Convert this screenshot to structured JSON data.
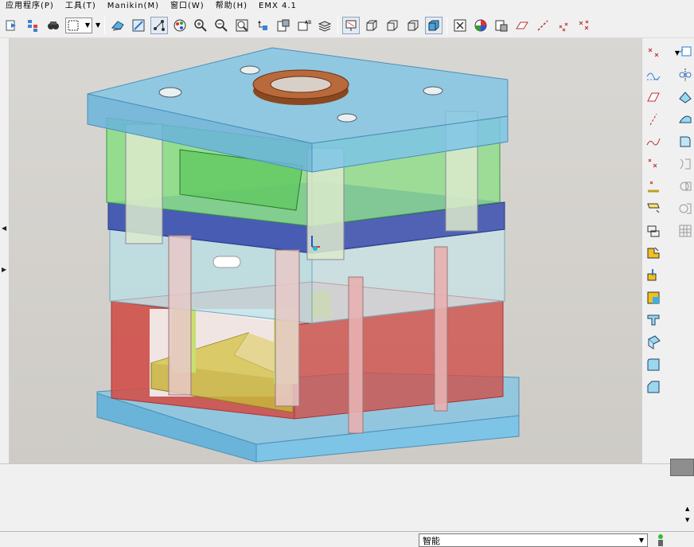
{
  "menubar": {
    "items": [
      "应用程序(P)",
      "工具(T)",
      "Manikin(M)",
      "窗口(W)",
      "帮助(H)",
      "EMX 4.1"
    ]
  },
  "toolbar": {
    "icons": [
      "regenerate-icon",
      "regenerate-manager-icon",
      "find-icon",
      "select-box-icon",
      "repaint-icon",
      "refit-icon",
      "spin-center-icon",
      "appearance-icon",
      "zoom-in-icon",
      "zoom-out-icon",
      "zoom-fit-icon",
      "orient-icon",
      "saved-views-icon",
      "layers-icon",
      "view-manager-icon",
      "wireframe-icon",
      "hidden-line-icon",
      "no-hidden-icon",
      "shaded-icon",
      "close-window-icon",
      "model-tree-icon",
      "datum-plane-icon",
      "datum-axis-icon",
      "datum-point-icon",
      "csys-icon"
    ]
  },
  "status": {
    "filter_value": "智能"
  },
  "colors": {
    "plate_blue": "#7ec4e6",
    "cavity_green": "#7ee07a",
    "stripper_blue": "#3a4fb0",
    "core_red": "#d0504a",
    "ejector_yellow": "#c8b43c",
    "sprue_ring": "#b86a3c"
  }
}
